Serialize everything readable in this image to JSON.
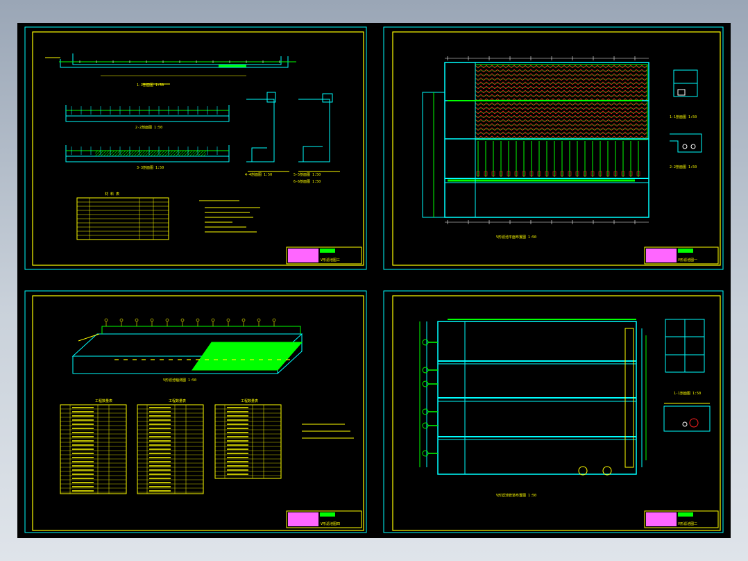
{
  "sheets": [
    {
      "id": "top-left",
      "views": [
        "1-1剖面图 1:50",
        "2-2剖面图 1:50",
        "3-3剖面图 1:50",
        "4-4剖面图 1:50",
        "5-5剖面图 1:50",
        "6-6剖面图 1:50"
      ],
      "tables": [
        {
          "title": "材 料 表"
        }
      ],
      "title_block": "V形滤池图三"
    },
    {
      "id": "top-right",
      "views": [
        "V形滤池平面布置图 1:50",
        "1-1剖面图 1:50",
        "2-2剖面图 1:50"
      ],
      "title_block": "V形滤池图一"
    },
    {
      "id": "bottom-left",
      "views": [
        "V形滤池轴测图 1:50"
      ],
      "tables": [
        {
          "title": "工程数量表"
        },
        {
          "title": "工程数量表"
        },
        {
          "title": "工程数量表"
        }
      ],
      "title_block": "V形滤池图四"
    },
    {
      "id": "bottom-right",
      "views": [
        "V形滤池管道布置图 1:50",
        "1-1剖面图 1:50"
      ],
      "title_block": "V形滤池图二"
    }
  ],
  "colors": {
    "background": "#000000",
    "frame": "#ffff00",
    "outer_frame": "#00ffff",
    "walls": "#00ffff",
    "pipes": "#00ff00",
    "rebar": "#ff2020",
    "text": "#ffff00",
    "title_block_fill": "#ff66ff"
  }
}
